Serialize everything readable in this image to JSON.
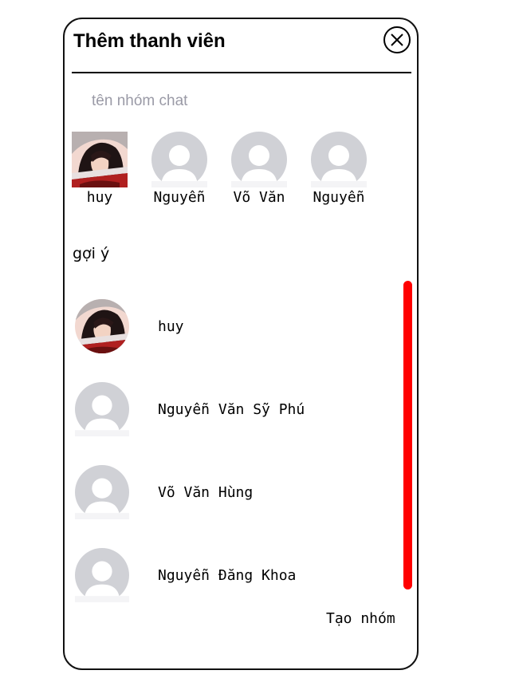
{
  "dialog": {
    "title": "Thêm thanh viên",
    "close_icon": "close-x-icon"
  },
  "group_name_input": {
    "placeholder": "tên nhóm chat",
    "value": ""
  },
  "selected_members": [
    {
      "name": "huy",
      "avatar": "anime-avatar-image"
    },
    {
      "name": "Nguyễn",
      "avatar": "default-user-icon"
    },
    {
      "name": "Võ Văn",
      "avatar": "default-user-icon"
    },
    {
      "name": "Nguyễn",
      "avatar": "default-user-icon"
    }
  ],
  "suggestions": {
    "label": "gợi ý",
    "items": [
      {
        "name": "huy",
        "avatar": "anime-avatar-image"
      },
      {
        "name": "Nguyễn Văn Sỹ Phú",
        "avatar": "default-user-icon"
      },
      {
        "name": "Võ Văn Hùng",
        "avatar": "default-user-icon"
      },
      {
        "name": "Nguyễn Đăng Khoa",
        "avatar": "default-user-icon"
      }
    ]
  },
  "actions": {
    "create_group_label": "Tạo nhóm"
  },
  "colors": {
    "scrollbar": "#ff0000",
    "default_avatar_bg": "#d0d1d6",
    "default_avatar_fg": "#ffffff",
    "border": "#111111"
  }
}
